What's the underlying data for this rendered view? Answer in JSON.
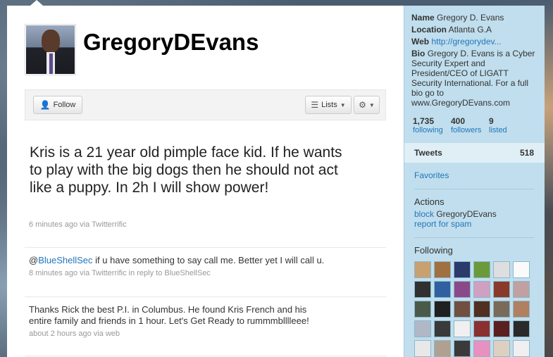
{
  "profile": {
    "screen_name": "GregoryDEvans",
    "name_label": "Name",
    "name": "Gregory D. Evans",
    "location_label": "Location",
    "location": "Atlanta G.A",
    "web_label": "Web",
    "web": "http://gregorydev...",
    "bio_label": "Bio",
    "bio": "Gregory D. Evans is a Cyber Security Expert and President/CEO of LIGATT Security International. For a full bio go to www.GregoryDEvans.com"
  },
  "actions": {
    "follow_label": "Follow",
    "lists_label": "Lists"
  },
  "featured_tweet": {
    "text": "Kris is a 21 year old pimple face kid. If he wants to play with the big dogs then he should not act like a puppy. In 2h I will show power!",
    "meta": "6 minutes ago via Twitterrific"
  },
  "tweets": [
    {
      "prefix": "@",
      "mention": "BlueShellSec",
      "text": " if u have something to say call me. Better yet I will call u.",
      "meta": "8 minutes ago via Twitterrific in reply to BlueShellSec"
    },
    {
      "text": "Thanks Rick the best P.I. in Columbus. He found Kris French and his entire family and friends in 1 hour. Let's Get Ready to rummmblllleee!",
      "meta": "about 2 hours ago via web"
    }
  ],
  "stats": [
    {
      "num": "1,735",
      "label": "following"
    },
    {
      "num": "400",
      "label": "followers"
    },
    {
      "num": "9",
      "label": "listed"
    }
  ],
  "sidebar": {
    "tweets_label": "Tweets",
    "tweets_count": "518",
    "favorites_label": "Favorites",
    "actions_heading": "Actions",
    "block_label": "block",
    "block_target": " GregoryDEvans",
    "report_label": "report for spam",
    "following_heading": "Following"
  },
  "following_colors": [
    "#c9a070",
    "#a07040",
    "#2a3a6a",
    "#6a9a3a",
    "#dedede",
    "#fafafa",
    "#303030",
    "#3060a0",
    "#8a4a8a",
    "#d0a0c0",
    "#8a3a2a",
    "#c0a0a0",
    "#4a5a4a",
    "#202020",
    "#705040",
    "#503020",
    "#7a6a5a",
    "#b08060",
    "#b0b8c8",
    "#3a3a3a",
    "#f0f0f0",
    "#8a3030",
    "#5a2020",
    "#2a2a2a",
    "#e8e8e8",
    "#b0a090",
    "#3a3a3a",
    "#e890c0",
    "#ddd0c0",
    "#f0f0f0"
  ],
  "colors": {
    "link": "#2276bb",
    "sidebar_bg": "#c0deed"
  }
}
